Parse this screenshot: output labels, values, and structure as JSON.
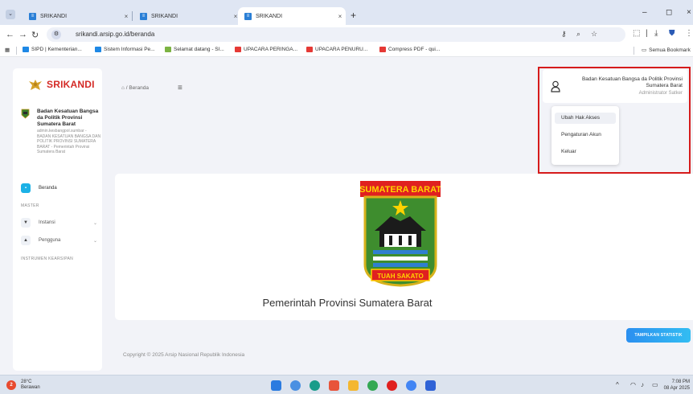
{
  "browser": {
    "tabs": [
      {
        "label": "SRIKANDI",
        "active": false
      },
      {
        "label": "SRIKANDI",
        "active": false
      },
      {
        "label": "SRIKANDI",
        "active": true
      }
    ],
    "url": "srikandi.arsip.go.id/beranda",
    "bookmarks": [
      {
        "label": "SIPD | Kementerian...",
        "color": "#1e88e5"
      },
      {
        "label": "Sistem Informasi Pe...",
        "color": "#1e88e5"
      },
      {
        "label": "Selamat datang - SI...",
        "color": "#7cb342"
      },
      {
        "label": "UPACARA PERINGA...",
        "color": "#e53935"
      },
      {
        "label": "UPACARA PENURU...",
        "color": "#e53935"
      },
      {
        "label": "Compress PDF - qui...",
        "color": "#e53935"
      }
    ],
    "all_bookmarks_label": "Semua Bookmark"
  },
  "sidebar": {
    "logo_text": "SRIKANDI",
    "org_name": "Badan Kesatuan Bangsa da Politik Provinsi Sumatera Barat",
    "org_detail": "admin.kesbangpol.sumbar - BADAN KESATUAN BANGSA DAN POLITIK PROVINSI SUMATERA BARAT - Pemerintah Provinsi Sumatera Barat",
    "menu_beranda": "Beranda",
    "section_master": "MASTER",
    "menu_instansi": "Instansi",
    "menu_pengguna": "Pengguna",
    "section_instrumen": "INSTRUMEN KEARSIPAN"
  },
  "header": {
    "breadcrumb": "/ Beranda"
  },
  "user": {
    "name": "Badan Kesatuan Bangsa da Politik Provinsi Sumatera Barat",
    "role": "Administrator Satker"
  },
  "dropdown": {
    "items": [
      "Ubah Hak Akses",
      "Pengaturan Akun",
      "Keluar"
    ]
  },
  "banner": {
    "crest_top_text": "SUMATERA BARAT",
    "crest_bottom_text": "TUAH SAKATO",
    "title": "Pemerintah Provinsi Sumatera Barat"
  },
  "actions": {
    "show_stats": "TAMPILKAN STATISTIK"
  },
  "footer": {
    "copyright": "Copyright © 2025 Arsip Nasional Republik Indonesia"
  },
  "taskbar": {
    "temperature": "28°C",
    "weather": "Berawan",
    "weather_badge": "2",
    "time": "7:08 PM",
    "date": "08 Apr 2025"
  },
  "colors": {
    "accent": "#1cb1e6",
    "highlight_box": "#d61b1b",
    "logo": "#d42a26"
  }
}
